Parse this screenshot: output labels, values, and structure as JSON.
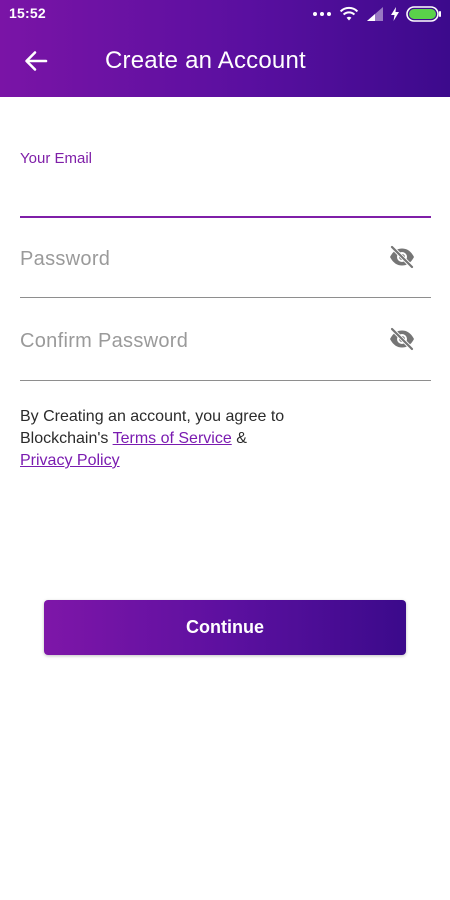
{
  "status_bar": {
    "time": "15:52"
  },
  "app_bar": {
    "title": "Create an Account",
    "back_icon": "arrow-left-icon"
  },
  "form": {
    "email": {
      "label": "Your Email",
      "value": ""
    },
    "password": {
      "placeholder": "Password",
      "value": "",
      "toggle_icon": "eye-off-icon"
    },
    "confirm_password": {
      "placeholder": "Confirm Password",
      "value": "",
      "toggle_icon": "eye-off-icon"
    }
  },
  "terms": {
    "text_before": "By Creating an account, you agree to Blockchain's",
    "terms_link": "Terms of Service",
    "ampersand": "&",
    "privacy_link": "Privacy Policy"
  },
  "actions": {
    "continue_label": "Continue"
  },
  "colors": {
    "brand_primary": "#7a14a6",
    "brand_secondary": "#3c0a8c",
    "input_focus": "#7f1fa8",
    "underline_inactive": "#8e8e8e"
  }
}
